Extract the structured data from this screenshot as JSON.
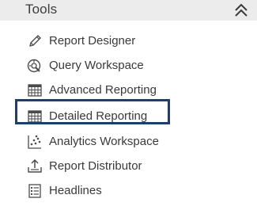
{
  "header": {
    "title": "Tools",
    "collapse_icon": "double-chevron-up-icon"
  },
  "menu": {
    "selected_index": 3,
    "selection_color": "#1f3f66",
    "items": [
      {
        "label": "Report Designer",
        "icon": "pencil-icon"
      },
      {
        "label": "Query Workspace",
        "icon": "query-icon"
      },
      {
        "label": "Advanced Reporting",
        "icon": "table-grid-icon"
      },
      {
        "label": "Detailed Reporting",
        "icon": "table-grid-icon"
      },
      {
        "label": "Analytics Workspace",
        "icon": "scatter-chart-icon"
      },
      {
        "label": "Report Distributor",
        "icon": "upload-tray-icon"
      },
      {
        "label": "Headlines",
        "icon": "list-icon"
      }
    ]
  }
}
